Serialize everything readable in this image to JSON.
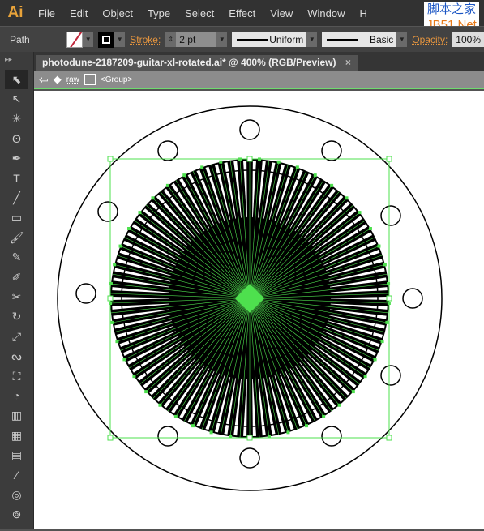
{
  "app": {
    "logo": "Ai",
    "menu": [
      "File",
      "Edit",
      "Object",
      "Type",
      "Select",
      "Effect",
      "View",
      "Window",
      "H"
    ]
  },
  "watermark": {
    "line1": "脚本之家",
    "line2": "JB51.Net"
  },
  "control": {
    "selection": "Path",
    "stroke_label": "Stroke:",
    "stroke_weight": "2 pt",
    "profile": "Uniform",
    "brush": "Basic",
    "opacity_label": "Opacity:",
    "opacity": "100%"
  },
  "document": {
    "tab_title": "photodune-2187209-guitar-xl-rotated.ai* @ 400% (RGB/Preview)",
    "close": "×"
  },
  "breadcrumb": {
    "layer": "raw",
    "group": "<Group>"
  },
  "colors": {
    "selection": "#4ee04e",
    "accent": "#e6953e"
  },
  "tools": [
    "selection",
    "direct-selection",
    "magic-wand",
    "lasso",
    "pen",
    "type",
    "line",
    "rectangle",
    "paintbrush",
    "pencil",
    "blob-brush",
    "scissors",
    "rotate",
    "scale",
    "warp",
    "free-transform",
    "shape-builder",
    "graph",
    "mesh",
    "gradient",
    "eyedropper",
    "blend",
    "symbol-sprayer"
  ]
}
